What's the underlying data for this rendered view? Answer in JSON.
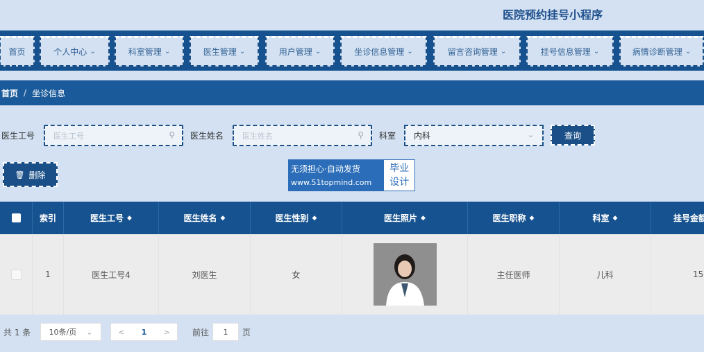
{
  "header": {
    "title": "医院预约挂号小程序"
  },
  "nav": [
    {
      "label": "首页",
      "has_menu": false
    },
    {
      "label": "个人中心",
      "has_menu": true
    },
    {
      "label": "科室管理",
      "has_menu": true
    },
    {
      "label": "医生管理",
      "has_menu": true
    },
    {
      "label": "用户管理",
      "has_menu": true
    },
    {
      "label": "坐诊信息管理",
      "has_menu": true
    },
    {
      "label": "留言咨询管理",
      "has_menu": true
    },
    {
      "label": "挂号信息管理",
      "has_menu": true
    },
    {
      "label": "病情诊断管理",
      "has_menu": true
    }
  ],
  "breadcrumb": {
    "home": "首页",
    "separator": "/",
    "current": "坐诊信息"
  },
  "search": {
    "doctor_id_label": "医生工号",
    "doctor_id_placeholder": "医生工号",
    "doctor_name_label": "医生姓名",
    "doctor_name_placeholder": "医生姓名",
    "department_label": "科室",
    "department_value": "内科",
    "query_button": "查询"
  },
  "actions": {
    "delete_button": "删除"
  },
  "watermark": {
    "line1": "无须担心·自动发货",
    "line2": "www.51topmind.com",
    "side1": "毕业",
    "side2": "设计"
  },
  "table": {
    "columns": [
      "索引",
      "医生工号",
      "医生姓名",
      "医生性别",
      "医生照片",
      "医生职称",
      "科室",
      "挂号金额"
    ],
    "sortable": [
      false,
      true,
      true,
      true,
      true,
      true,
      true,
      true
    ],
    "rows": [
      {
        "index": "1",
        "doctor_id": "医生工号4",
        "doctor_name": "刘医生",
        "gender": "女",
        "title": "主任医师",
        "department": "儿科",
        "fee": "15"
      }
    ]
  },
  "pagination": {
    "total_text": "共 1 条",
    "page_size": "10条/页",
    "prev": "<",
    "current_page": "1",
    "next": ">",
    "goto_label": "前往",
    "goto_value": "1",
    "page_unit": "页"
  },
  "colors": {
    "nav_bg": "#16528f",
    "accent": "#1a4f87",
    "page_bg": "#d3e1f2"
  },
  "icons": {
    "search": "search-icon",
    "dropdown": "chevron-down-icon",
    "delete": "trash-icon",
    "sort": "sort-icon"
  }
}
